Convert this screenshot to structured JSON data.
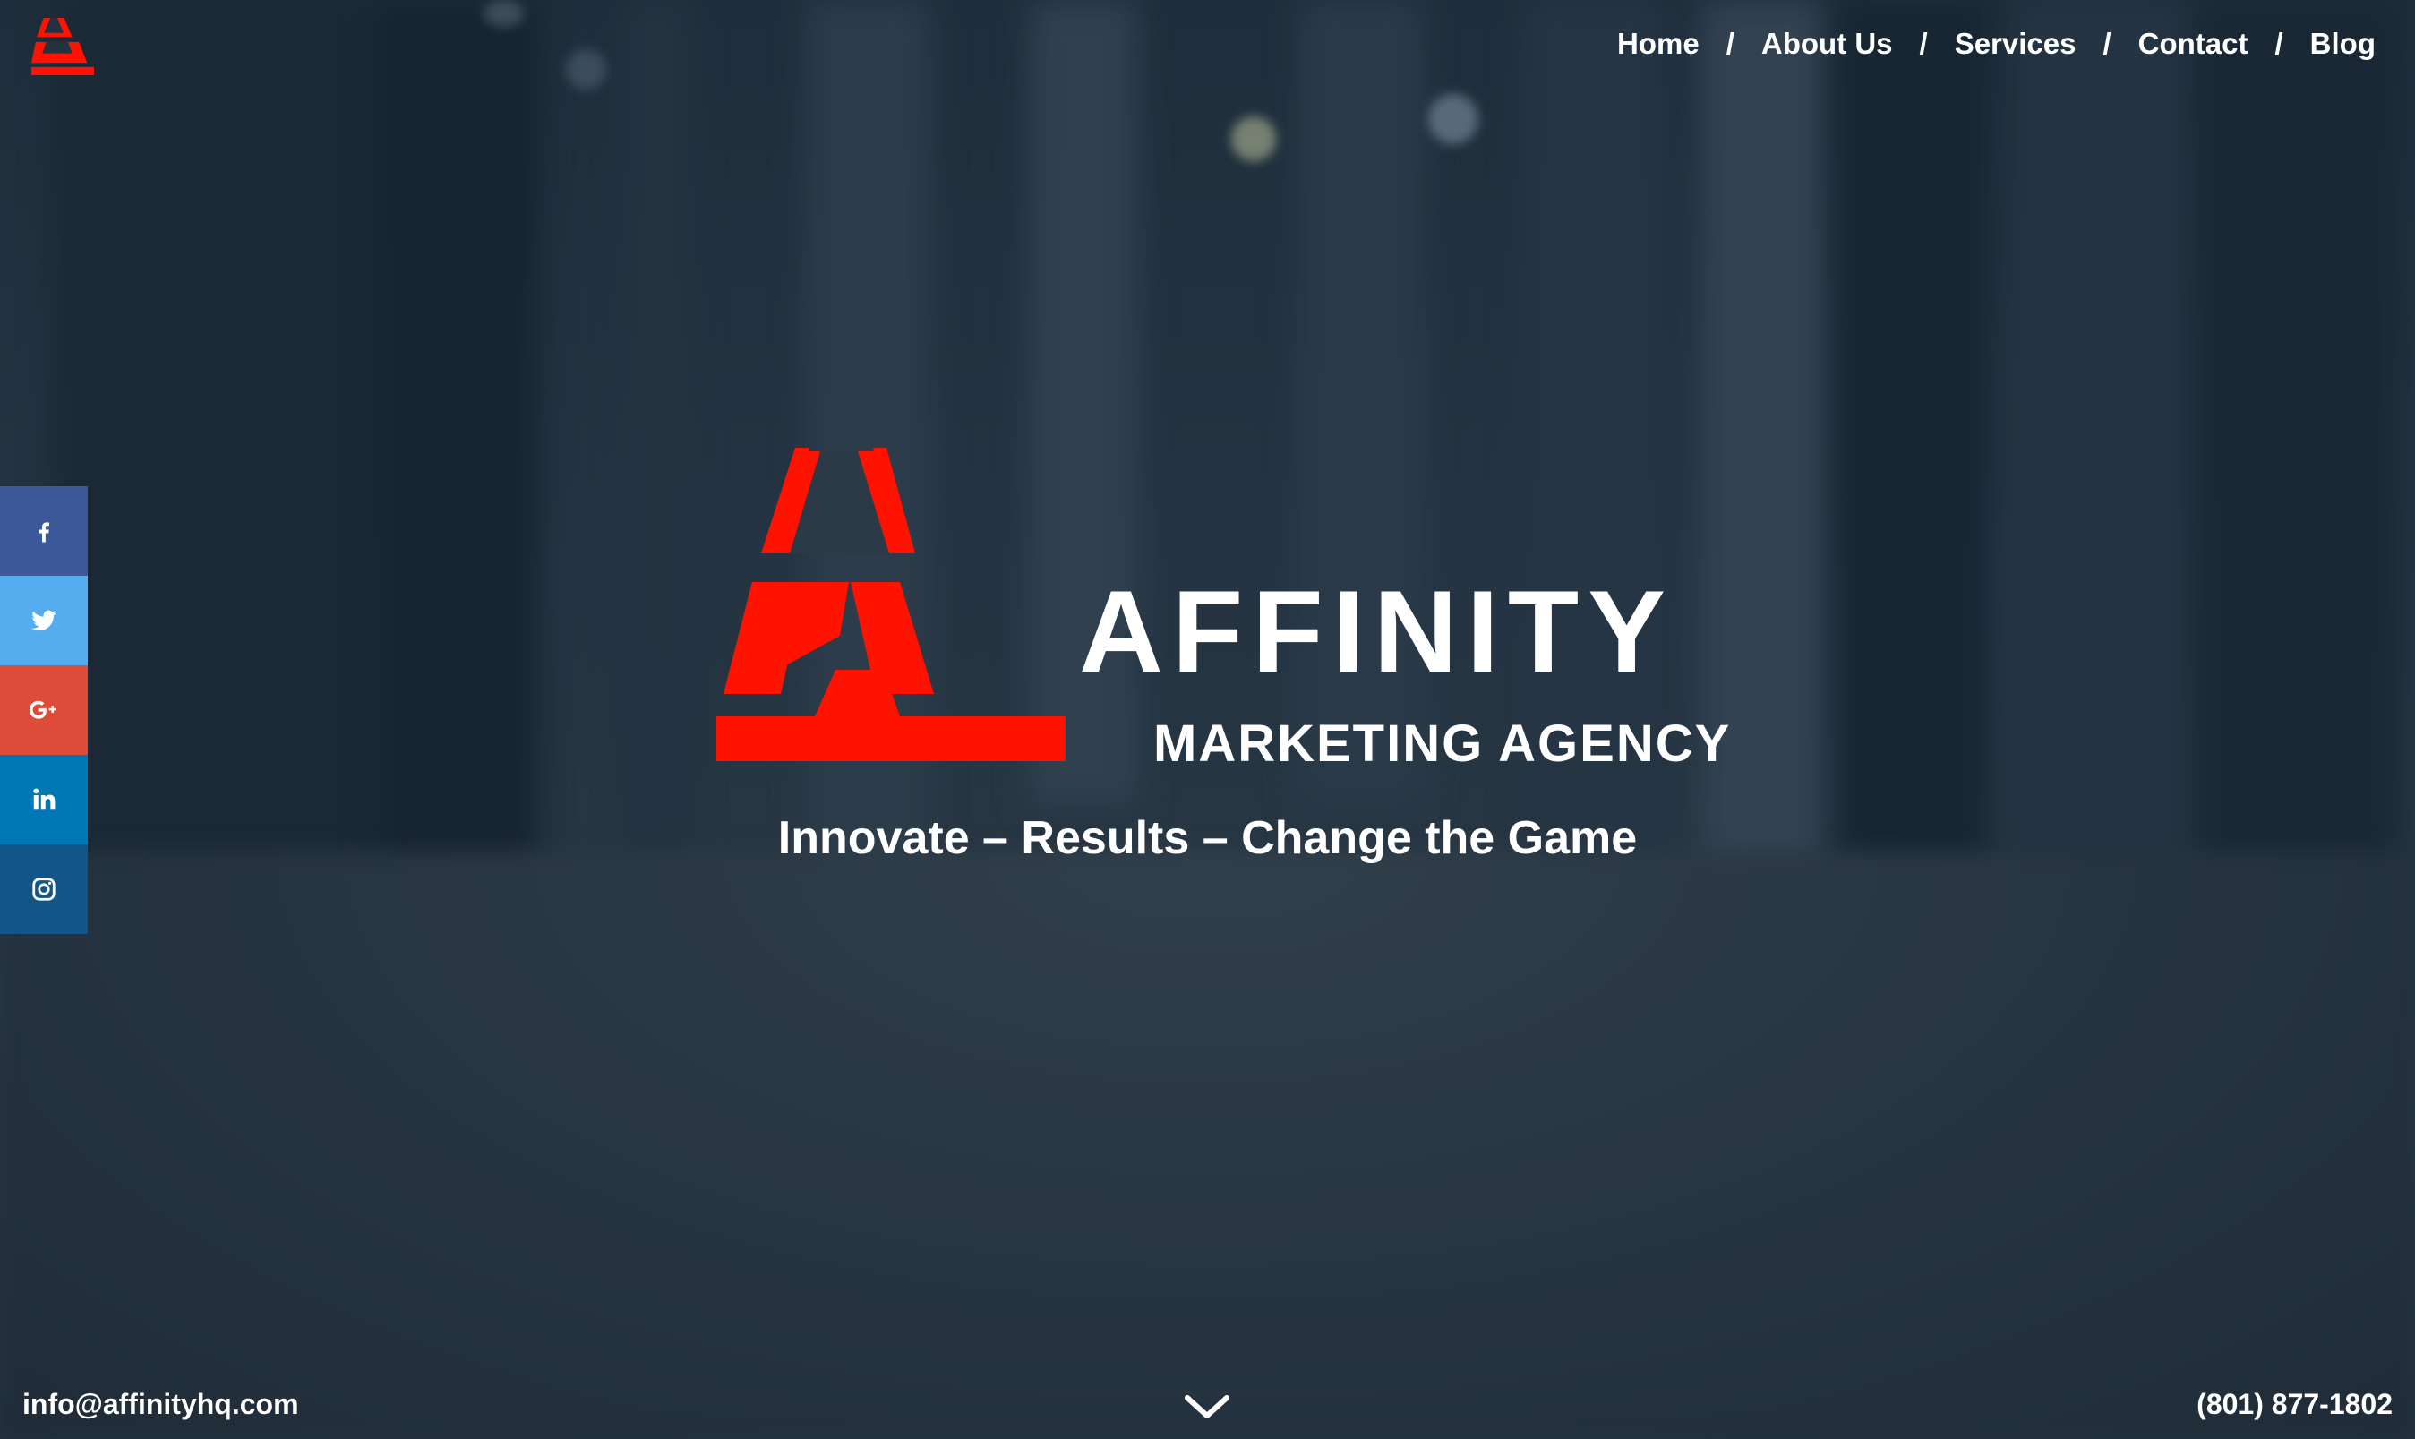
{
  "nav": {
    "items": [
      {
        "label": "Home"
      },
      {
        "label": "About Us"
      },
      {
        "label": "Services"
      },
      {
        "label": "Contact"
      },
      {
        "label": "Blog"
      }
    ],
    "separator": "/"
  },
  "social": [
    {
      "icon": "facebook-icon",
      "color": "#3b5998"
    },
    {
      "icon": "twitter-icon",
      "color": "#55acee"
    },
    {
      "icon": "google-plus-icon",
      "color": "#dd4b39"
    },
    {
      "icon": "linkedin-icon",
      "color": "#0077b5"
    },
    {
      "icon": "instagram-icon",
      "color": "#125688"
    }
  ],
  "hero": {
    "brand": "AFFINITY",
    "subtitle": "MARKETING AGENCY",
    "tagline": "Innovate – Results – Change the Game"
  },
  "footer": {
    "email": "info@affinityhq.com",
    "phone": "(801) 877-1802"
  },
  "colors": {
    "brand_red": "#ff1200",
    "text": "#ffffff"
  }
}
